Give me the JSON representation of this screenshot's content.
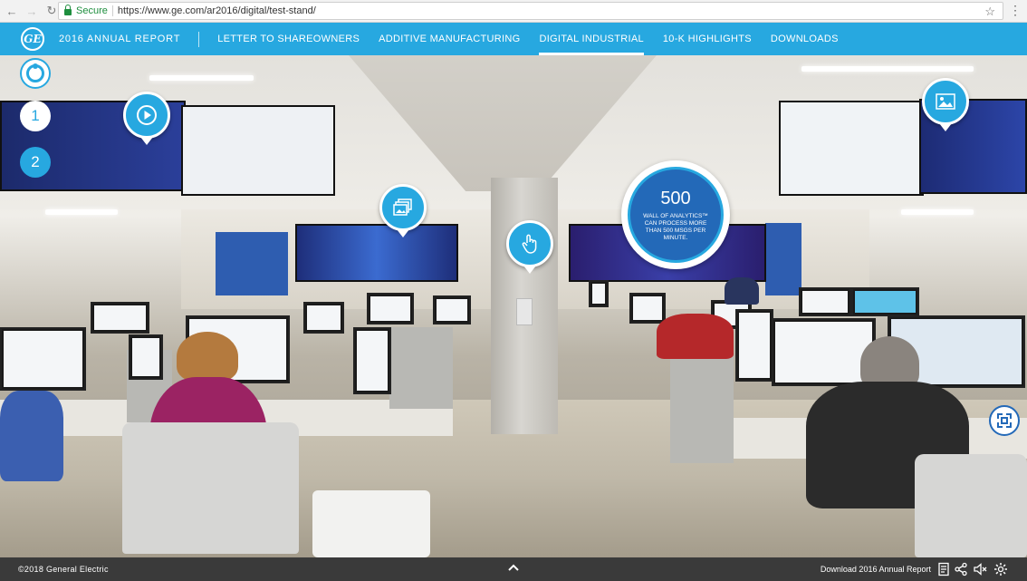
{
  "browser": {
    "secure_label": "Secure",
    "url": "https://www.ge.com/ar2016/digital/test-stand/",
    "back_icon": "arrow-left-icon",
    "forward_icon": "arrow-right-icon",
    "reload_icon": "reload-icon",
    "star_icon": "star-icon"
  },
  "header": {
    "logo_text": "GE",
    "title": "2016 ANNUAL REPORT",
    "nav": [
      {
        "label": "LETTER TO SHAREOWNERS",
        "active": false
      },
      {
        "label": "ADDITIVE MANUFACTURING",
        "active": false
      },
      {
        "label": "DIGITAL INDUSTRIAL",
        "active": true
      },
      {
        "label": "10-K HIGHLIGHTS",
        "active": false
      },
      {
        "label": "DOWNLOADS",
        "active": false
      }
    ],
    "accent_color": "#27a8e0"
  },
  "steps": [
    {
      "label": "1"
    },
    {
      "label": "2"
    }
  ],
  "hotspots": {
    "video_icon": "play-icon",
    "gallery_icon": "gallery-icon",
    "touch_icon": "touch-icon",
    "image_icon": "image-icon"
  },
  "stat": {
    "number": "500",
    "text": "WALL OF ANALYTICS™ CAN PROCESS MORE THAN 500 MSGS PER MINUTE."
  },
  "footer": {
    "copyright": "©2018 General Electric",
    "download_label": "Download 2016 Annual Report"
  }
}
